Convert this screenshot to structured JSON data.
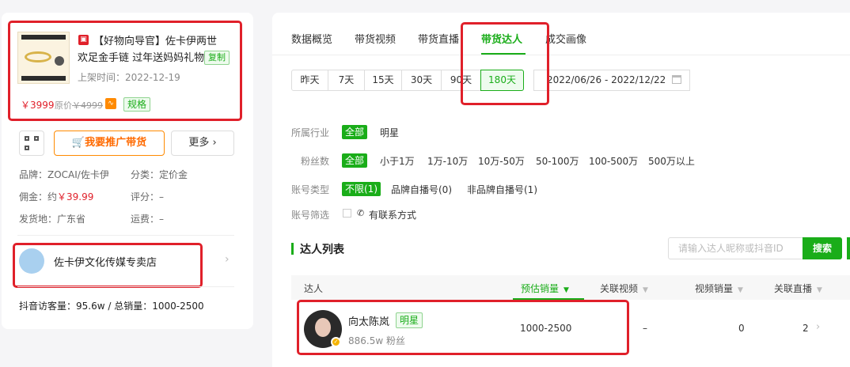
{
  "product": {
    "title_line1": "【好物向导官】佐卡伊两世",
    "title_line2": "欢足金手链 过年送妈妈礼物",
    "copy_label": "复制",
    "listing_time": "上架时间：2022-12-19",
    "price": "￥3999",
    "orig_price_prefix": "原价",
    "orig_price": "￥4999",
    "spec_label": "规格",
    "promo_label": "我要推广带货",
    "more_label": "更多 ›",
    "brand": "品牌：ZOCAI/佐卡伊",
    "category": "分类：定价金",
    "commission_prefix": "佣金：约",
    "commission": "￥39.99",
    "rating": "评分：–",
    "origin": "发货地：广东省",
    "shipping": "运费：–",
    "shop_name": "佐卡伊文化传媒专卖店",
    "stats": "抖音访客量：95.6w / 总销量：1000-2500"
  },
  "tabs": [
    "数据概览",
    "带货视频",
    "带货直播",
    "带货达人",
    "成交画像"
  ],
  "date_filters": [
    "昨天",
    "7天",
    "15天",
    "30天",
    "90天",
    "180天"
  ],
  "date_range": "2022/06/26  - 2022/12/22",
  "filters": {
    "industry_label": "所属行业",
    "industry_options": [
      "全部",
      "明星"
    ],
    "fans_label": "粉丝数",
    "fans_options": [
      "全部",
      "小于1万",
      "1万-10万",
      "10万-50万",
      "50-100万",
      "100-500万",
      "500万以上"
    ],
    "account_type_label": "账号类型",
    "account_type_options": [
      "不限(1)",
      "品牌自播号(0)",
      "非品牌自播号(1)"
    ],
    "account_filter_label": "账号筛选",
    "contact_label": "有联系方式"
  },
  "talent_list": {
    "title": "达人列表",
    "search_placeholder": "请输入达人昵称或抖音ID",
    "search_label": "搜索",
    "columns": [
      "达人",
      "预估销量",
      "关联视频",
      "视频销量",
      "关联直播"
    ],
    "rows": [
      {
        "name": "向太陈岚",
        "tag": "明星",
        "fans": "886.5w 粉丝",
        "est_sales": "1000-2500",
        "videos": "–",
        "video_sales": "0",
        "lives": "2"
      }
    ]
  }
}
